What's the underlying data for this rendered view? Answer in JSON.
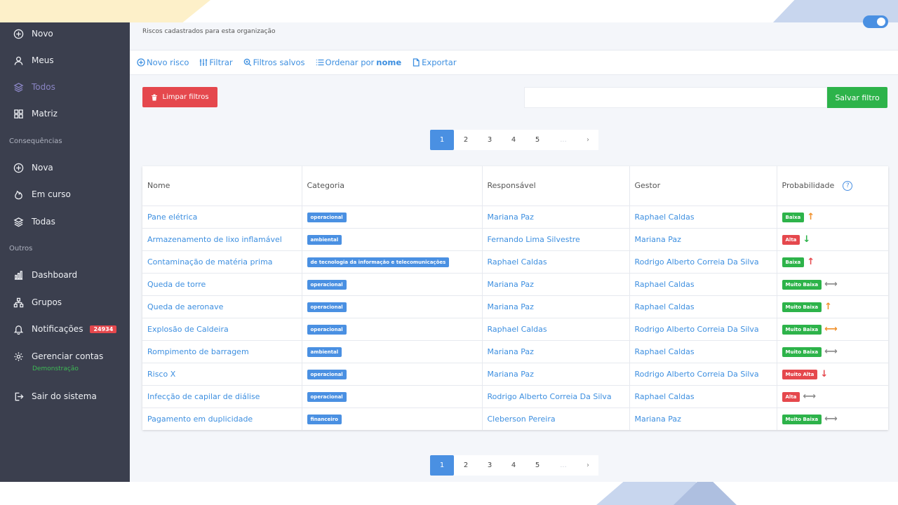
{
  "header": {
    "subtitle": "Riscos cadastrados para esta organização"
  },
  "sidebar": {
    "items": [
      {
        "label": "Novo",
        "icon": "plus-circle-icon"
      },
      {
        "label": "Meus",
        "icon": "user-icon"
      },
      {
        "label": "Todos",
        "icon": "layers-icon",
        "active": true
      },
      {
        "label": "Matriz",
        "icon": "grid-icon"
      },
      {
        "label": "Nova",
        "icon": "plus-circle-icon"
      },
      {
        "label": "Em curso",
        "icon": "fire-icon"
      },
      {
        "label": "Todas",
        "icon": "layers-icon"
      },
      {
        "label": "Dashboard",
        "icon": "bar-chart-icon"
      },
      {
        "label": "Grupos",
        "icon": "hierarchy-icon"
      },
      {
        "label": "Notificações",
        "icon": "bell-icon",
        "badge": "24934"
      },
      {
        "label": "Gerenciar contas",
        "icon": "gear-icon",
        "sub": "Demonstração"
      },
      {
        "label": "Sair do sistema",
        "icon": "logout-icon"
      }
    ],
    "sections": {
      "consequences": "Consequências",
      "others": "Outros"
    }
  },
  "toolbar": {
    "new_risk": "Novo risco",
    "filter": "Filtrar",
    "saved_filters": "Filtros salvos",
    "order_by": "Ordenar por",
    "order_by_field": "nome",
    "export": "Exportar"
  },
  "filters": {
    "clear_label": "Limpar filtros",
    "save_label": "Salvar filtro",
    "name_value": ""
  },
  "pagination": {
    "pages": [
      "1",
      "2",
      "3",
      "4",
      "5"
    ],
    "current": "1",
    "ellipsis": "...",
    "next": "›"
  },
  "table": {
    "headers": [
      "Nome",
      "Categoria",
      "Responsável",
      "Gestor",
      "Probabilidade"
    ],
    "rows": [
      {
        "name": "Pane elétrica",
        "category": "operacional",
        "responsible": "Mariana Paz",
        "manager": "Raphael Caldas",
        "probability": "Baixa",
        "prob_color": "#2db34a",
        "trend": "up",
        "trend_color": "#f0902a"
      },
      {
        "name": "Armazenamento de lixo inflamável",
        "category": "ambiental",
        "responsible": "Fernando Lima Silvestre",
        "manager": "Mariana Paz",
        "probability": "Alta",
        "prob_color": "#e5484d",
        "trend": "down",
        "trend_color": "#2db34a"
      },
      {
        "name": "Contaminação de matéria prima",
        "category": "de tecnologia da informação e telecomunicações",
        "responsible": "Raphael Caldas",
        "manager": "Rodrigo Alberto Correia Da Silva",
        "probability": "Baixa",
        "prob_color": "#2db34a",
        "trend": "up",
        "trend_color": "#e5484d"
      },
      {
        "name": "Queda de torre",
        "category": "operacional",
        "responsible": "Mariana Paz",
        "manager": "Raphael Caldas",
        "probability": "Muito Baixa",
        "prob_color": "#2db34a",
        "trend": "flat",
        "trend_color": "#888888"
      },
      {
        "name": "Queda de aeronave",
        "category": "operacional",
        "responsible": "Mariana Paz",
        "manager": "Raphael Caldas",
        "probability": "Muito Baixa",
        "prob_color": "#2db34a",
        "trend": "up",
        "trend_color": "#f0902a"
      },
      {
        "name": "Explosão de Caldeira",
        "category": "operacional",
        "responsible": "Raphael Caldas",
        "manager": "Rodrigo Alberto Correia Da Silva",
        "probability": "Muito Baixa",
        "prob_color": "#2db34a",
        "trend": "flat",
        "trend_color": "#f0902a"
      },
      {
        "name": "Rompimento de barragem",
        "category": "ambiental",
        "responsible": "Mariana Paz",
        "manager": "Raphael Caldas",
        "probability": "Muito Baixa",
        "prob_color": "#2db34a",
        "trend": "flat",
        "trend_color": "#888888"
      },
      {
        "name": "Risco X",
        "category": "operacional",
        "responsible": "Mariana Paz",
        "manager": "Rodrigo Alberto Correia Da Silva",
        "probability": "Muito Alta",
        "prob_color": "#e5484d",
        "trend": "down",
        "trend_color": "#e5484d"
      },
      {
        "name": "Infecção de capilar de diálise",
        "category": "operacional",
        "responsible": "Rodrigo Alberto Correia Da Silva",
        "manager": "Raphael Caldas",
        "probability": "Alta",
        "prob_color": "#e5484d",
        "trend": "flat",
        "trend_color": "#888888"
      },
      {
        "name": "Pagamento em duplicidade",
        "category": "financeiro",
        "responsible": "Cleberson Pereira",
        "manager": "Mariana Paz",
        "probability": "Muito Baixa",
        "prob_color": "#2db34a",
        "trend": "flat",
        "trend_color": "#888888"
      }
    ]
  }
}
